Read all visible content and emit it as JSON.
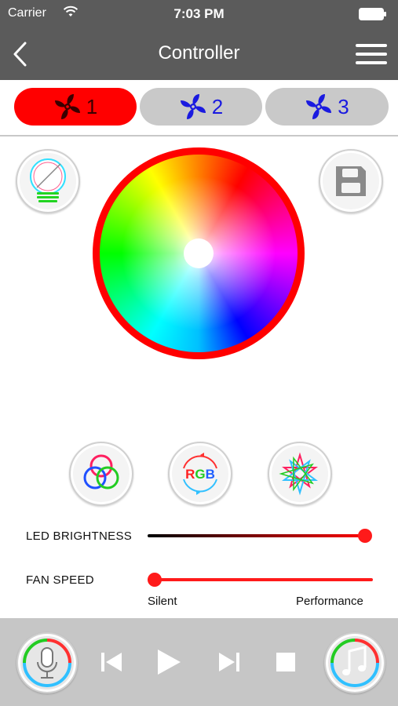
{
  "status": {
    "carrier": "Carrier",
    "time": "7:03 PM"
  },
  "nav": {
    "title": "Controller"
  },
  "tabs": [
    {
      "label": "1",
      "active": true
    },
    {
      "label": "2",
      "active": false
    },
    {
      "label": "3",
      "active": false
    }
  ],
  "sliders": {
    "led_brightness": {
      "label": "LED  BRIGHTNESS",
      "value": 1.0
    },
    "fan_speed": {
      "label": "FAN SPEED",
      "value": 0.0,
      "min_label": "Silent",
      "max_label": "Performance"
    }
  },
  "mode_buttons": {
    "rgb_text": "RGB"
  },
  "colors": {
    "accent": "#ff0000",
    "bar": "#5b5b5b",
    "fan_icon": "#1a1ae0",
    "bottom_bar": "#c6c6c6"
  },
  "icons": [
    "wifi-icon",
    "battery-icon",
    "back-chevron-icon",
    "menu-icon",
    "fan-icon",
    "bulb-icon",
    "save-icon",
    "color-mix-icon",
    "rgb-cycle-icon",
    "star-icon",
    "microphone-icon",
    "previous-icon",
    "play-icon",
    "next-icon",
    "stop-icon",
    "music-note-icon"
  ]
}
